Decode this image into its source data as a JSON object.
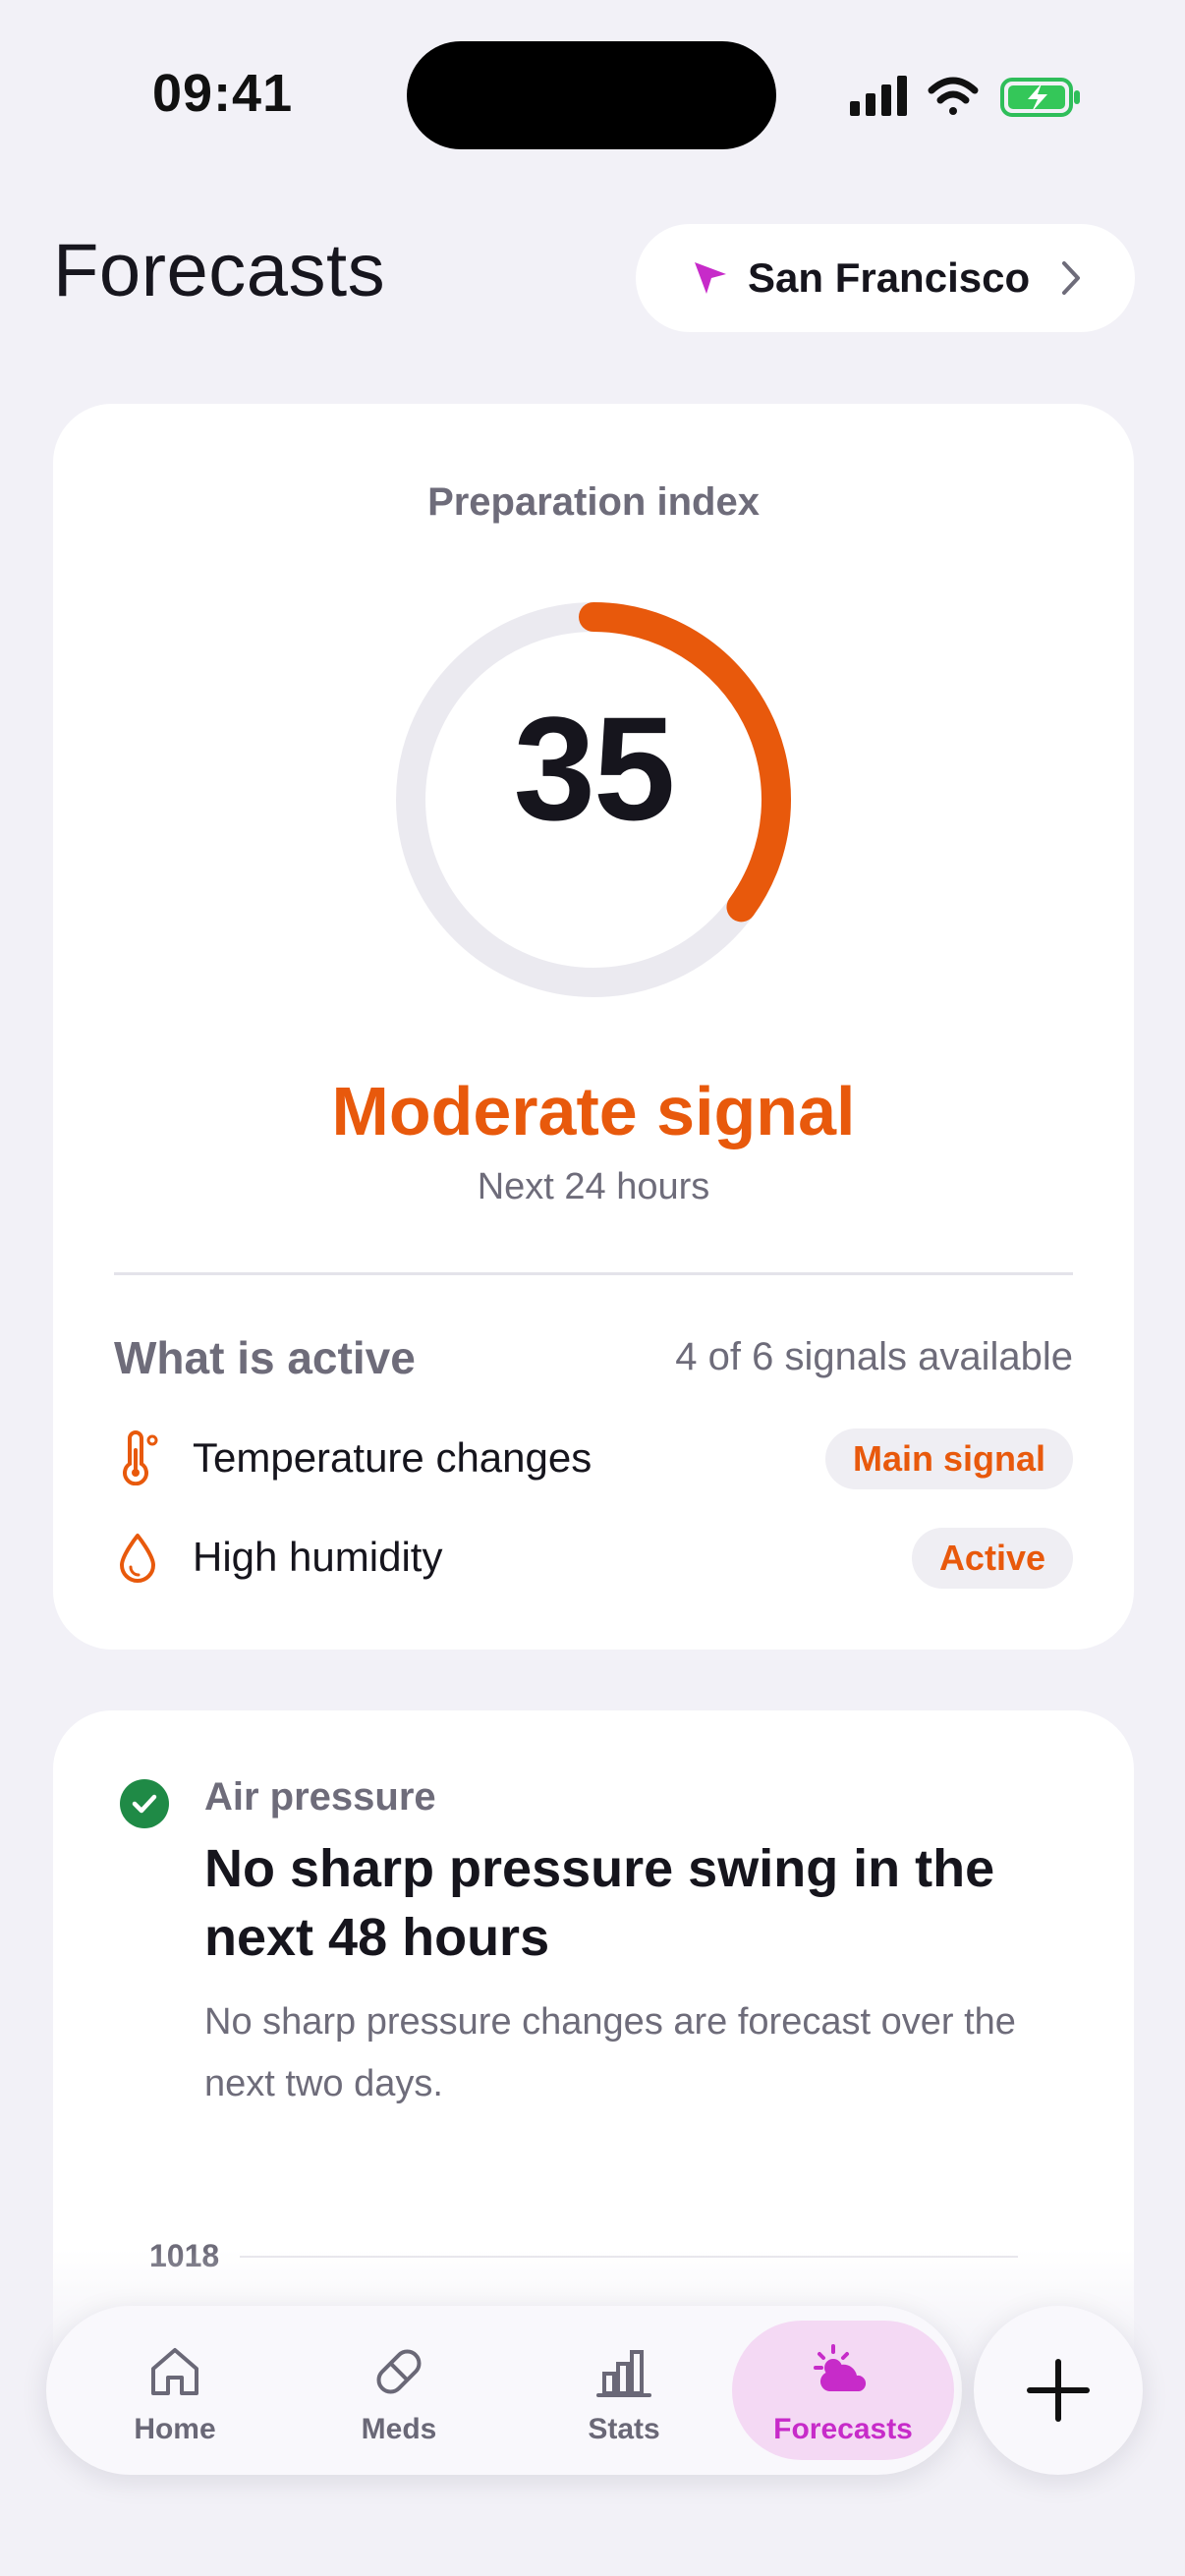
{
  "status_bar": {
    "time": "09:41"
  },
  "header": {
    "title": "Forecasts",
    "location": "San Francisco"
  },
  "index_card": {
    "label": "Preparation index",
    "value": "35",
    "value_fraction": 0.35,
    "level": "Moderate signal",
    "range": "Next 24 hours",
    "active_heading": "What is active",
    "active_count": "4 of 6 signals available",
    "factors": [
      {
        "label": "Temperature changes",
        "badge": "Main signal",
        "icon": "thermometer-icon"
      },
      {
        "label": "High humidity",
        "badge": "Active",
        "icon": "droplet-icon"
      }
    ]
  },
  "pressure_card": {
    "kicker": "Air pressure",
    "title": "No sharp pressure swing in the next 48 hours",
    "body": "No sharp pressure changes are forecast over the next two days.",
    "axis_top": "1018"
  },
  "tabbar": {
    "tabs": [
      {
        "label": "Home",
        "icon": "home-icon"
      },
      {
        "label": "Meds",
        "icon": "pill-icon"
      },
      {
        "label": "Stats",
        "icon": "bar-chart-icon"
      },
      {
        "label": "Forecasts",
        "icon": "cloud-sun-icon",
        "active": true
      }
    ],
    "add_icon": "plus-icon"
  },
  "colors": {
    "accent": "#e8590c",
    "brand": "#c72bc9",
    "success": "#1f8a46",
    "background": "#f2f1f7"
  }
}
